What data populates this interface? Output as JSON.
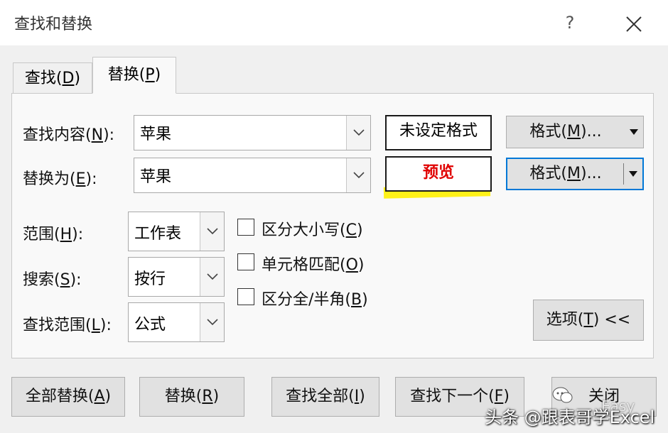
{
  "dialog": {
    "title": "查找和替换",
    "help": "?"
  },
  "tabs": {
    "find": {
      "text": "查找(",
      "key": "D",
      "end": ")"
    },
    "replace": {
      "text": "替换(",
      "key": "P",
      "end": ")"
    }
  },
  "find_what": {
    "label": {
      "text": "查找内容(",
      "key": "N",
      "end": "):"
    },
    "value": "苹果",
    "format_status": "未设定格式",
    "format_button": {
      "text": "格式(",
      "key": "M",
      "end": ")..."
    }
  },
  "replace_with": {
    "label": {
      "text": "替换为(",
      "key": "E",
      "end": "):"
    },
    "value": "苹果",
    "format_preview": "预览",
    "format_button": {
      "text": "格式(",
      "key": "M",
      "end": ")..."
    }
  },
  "options": {
    "within": {
      "label": {
        "text": "范围(",
        "key": "H",
        "end": "):"
      },
      "value": "工作表"
    },
    "search": {
      "label": {
        "text": "搜索(",
        "key": "S",
        "end": "):"
      },
      "value": "按行"
    },
    "look_in": {
      "label": {
        "text": "查找范围(",
        "key": "L",
        "end": "):"
      },
      "value": "公式"
    },
    "match_case": {
      "text": "区分大小写(",
      "key": "C",
      "end": ")",
      "checked": false
    },
    "match_entire": {
      "text": "单元格匹配(",
      "key": "O",
      "end": ")",
      "checked": false
    },
    "match_byte": {
      "text": "区分全/半角(",
      "key": "B",
      "end": ")",
      "checked": false
    },
    "options_button": {
      "text": "选项(",
      "key": "T",
      "end": ") <<"
    }
  },
  "actions": {
    "replace_all": {
      "text": "全部替换(",
      "key": "A",
      "end": ")"
    },
    "replace": {
      "text": "替换(",
      "key": "R",
      "end": ")"
    },
    "find_all": {
      "text": "查找全部(",
      "key": "I",
      "end": ")"
    },
    "find_next": {
      "text": "查找下一个(",
      "key": "F",
      "end": ")"
    },
    "close": {
      "text": "关闭"
    }
  },
  "watermark": {
    "text": "头条 @跟表哥学Excel",
    "faint": "Easy"
  },
  "colors": {
    "accent": "#0078d7",
    "preview_text": "#e00000",
    "highlight": "#ffef00"
  }
}
